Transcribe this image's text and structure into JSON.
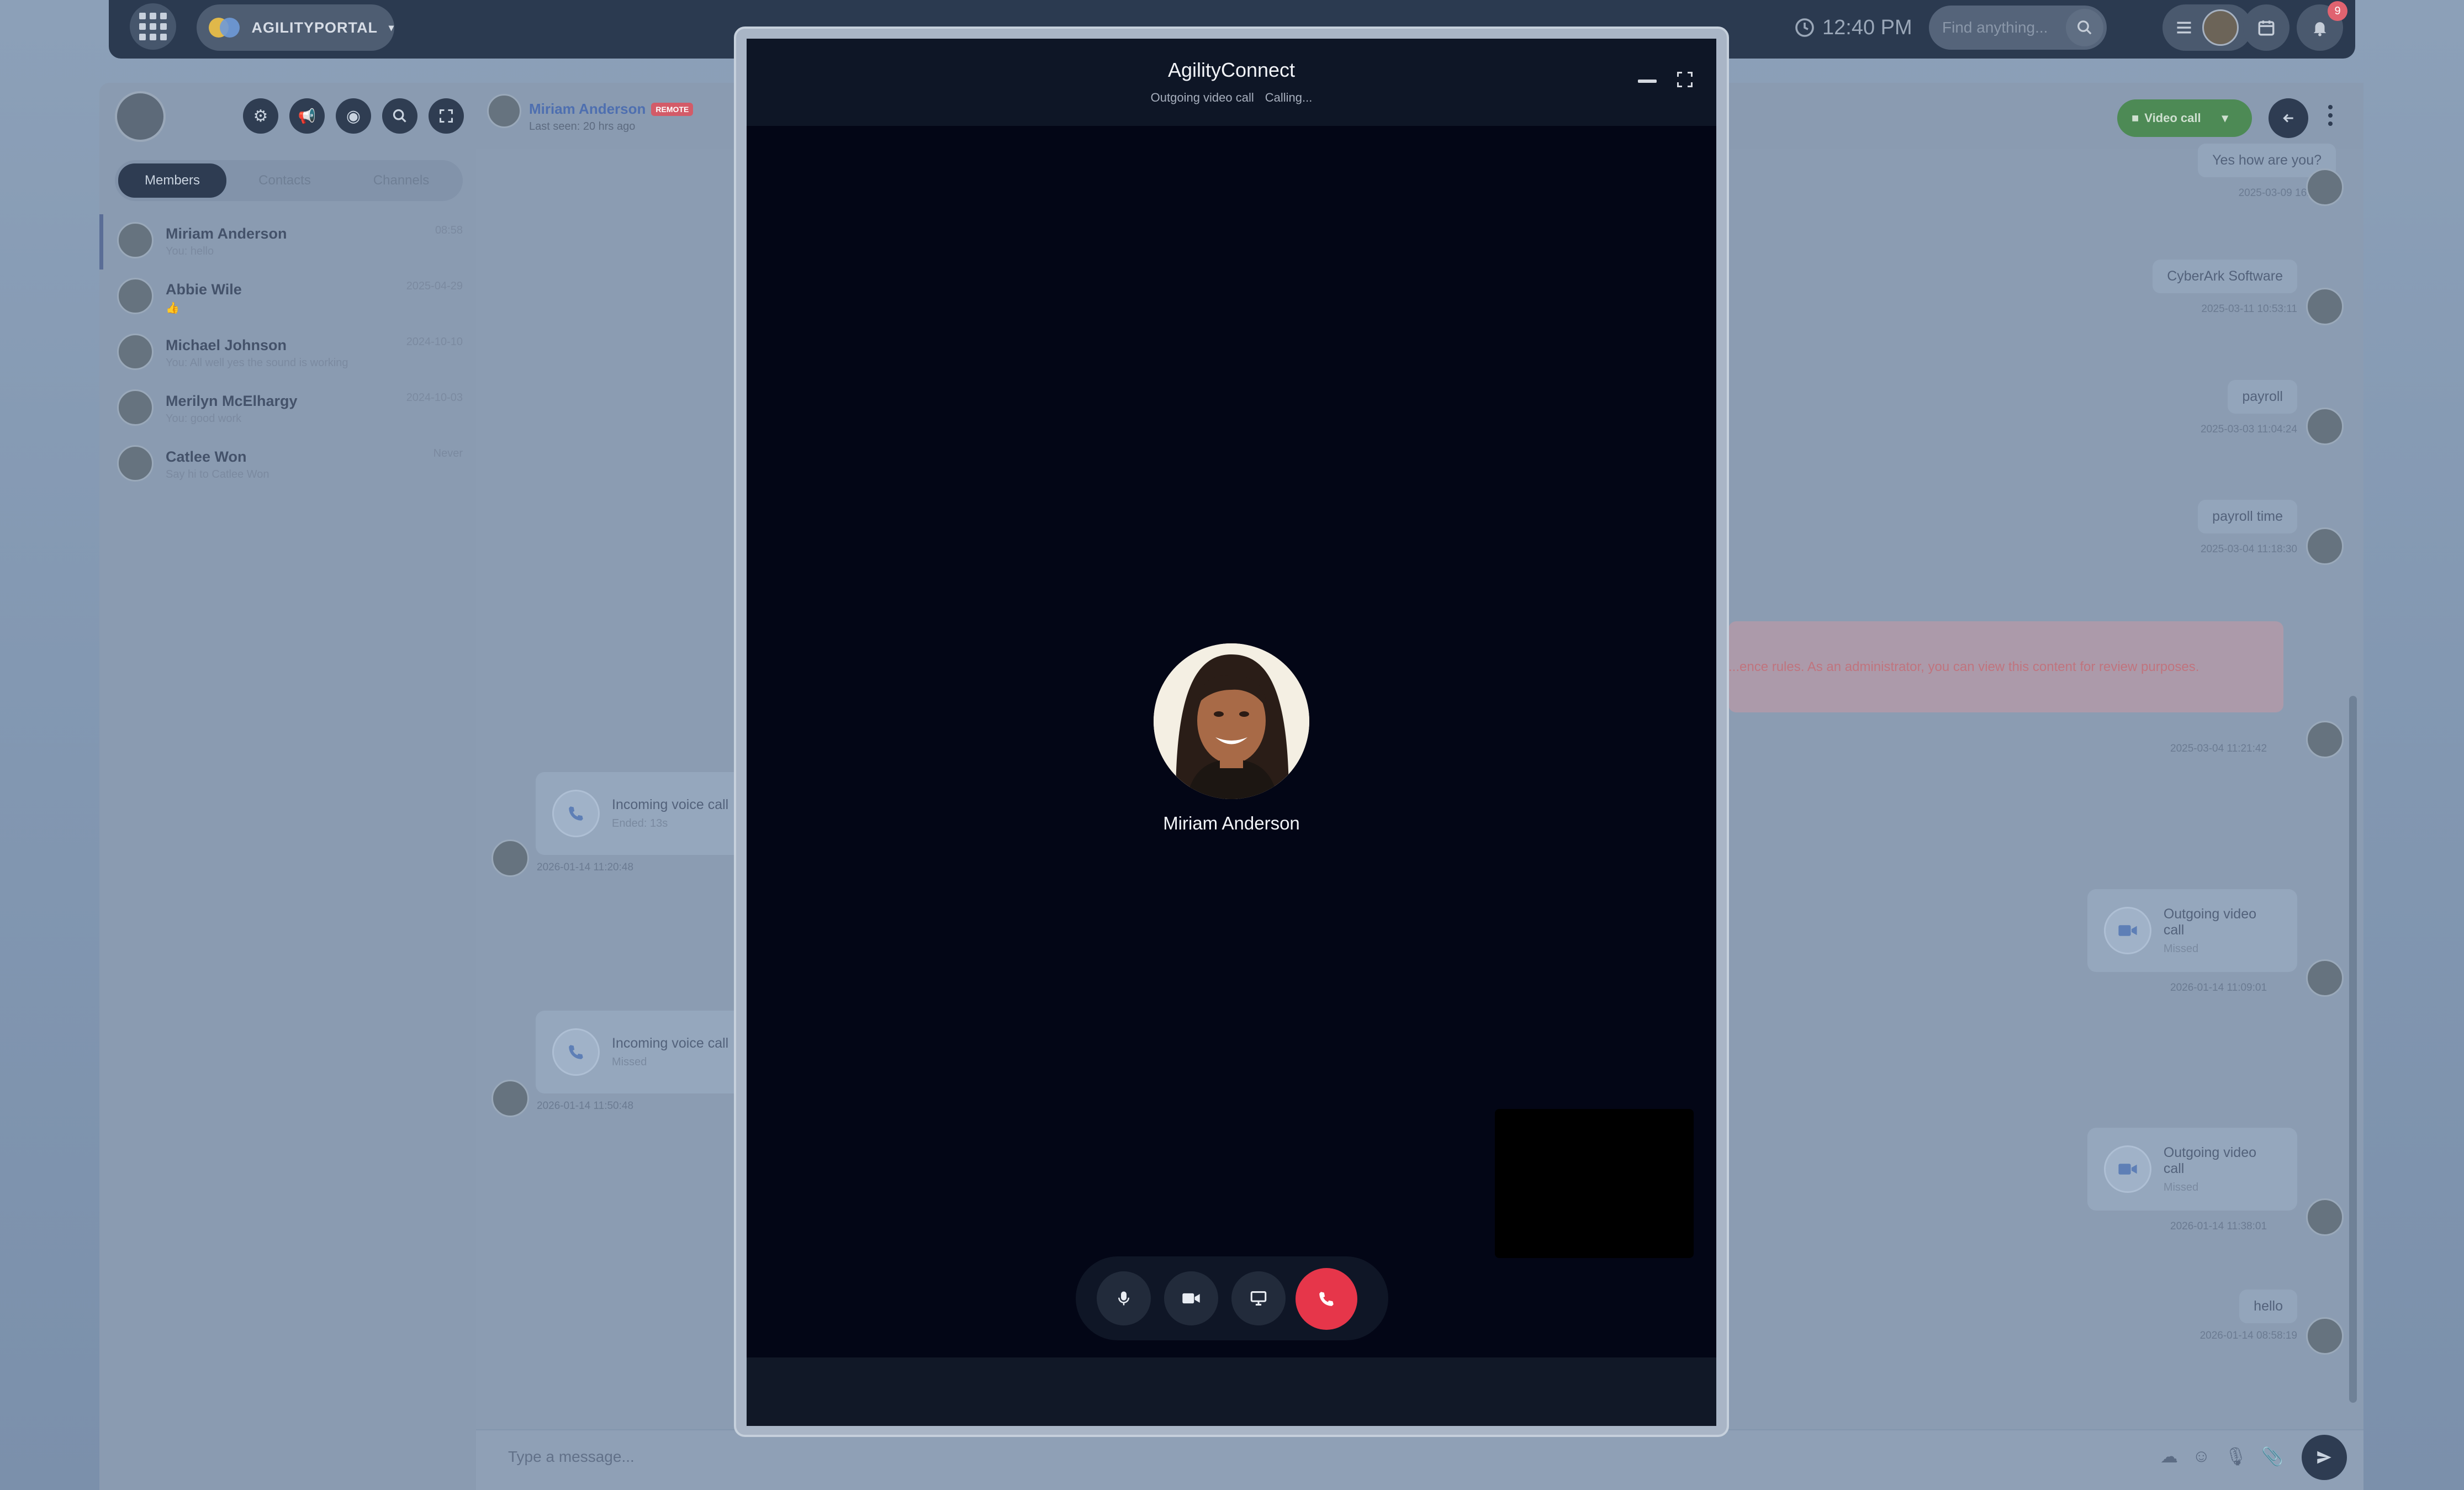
{
  "app": {
    "brand": "AGILITYPORTAL",
    "time": "12:40 PM",
    "search_placeholder": "Find anything...",
    "notification_count": "9"
  },
  "sidebar": {
    "tabs": [
      {
        "label": "Members"
      },
      {
        "label": "Contacts"
      },
      {
        "label": "Channels"
      }
    ],
    "contacts": [
      {
        "name": "Miriam Anderson",
        "preview": "You: hello",
        "date": "08:58"
      },
      {
        "name": "Abbie Wile",
        "preview": "👍",
        "date": "2025-04-29"
      },
      {
        "name": "Michael Johnson",
        "preview": "You: All well yes the sound is working",
        "date": "2024-10-10"
      },
      {
        "name": "Merilyn McElhargy",
        "preview": "You: good work",
        "date": "2024-10-03"
      },
      {
        "name": "Catlee Won",
        "preview": "Say hi to Catlee Won",
        "date": "Never"
      }
    ]
  },
  "chat": {
    "contact_name": "Miriam Anderson",
    "contact_badge": "REMOTE",
    "last_seen": "Last seen: 20 hrs ago",
    "video_call_label": "Video call",
    "composer_placeholder": "Type a message...",
    "messages_right": [
      {
        "text": "Yes how are you?",
        "time": "2025-03-09 16:39:06"
      },
      {
        "text": "CyberArk Software",
        "time": "2025-03-11 10:53:11"
      },
      {
        "text": "payroll",
        "time": "2025-03-03 11:04:24"
      },
      {
        "text": "payroll time",
        "time": "2025-03-04 11:18:30"
      }
    ],
    "admin_note": "...ence rules. As an administrator, you can view this content for review purposes.",
    "admin_note_time": "2025-03-04 11:21:42",
    "calls_left": [
      {
        "title": "Incoming voice call",
        "status": "Ended: 13s",
        "time": "2026-01-14 11:20:48"
      },
      {
        "title": "Incoming voice call",
        "status": "Missed",
        "time": "2026-01-14 11:50:48"
      }
    ],
    "calls_right": [
      {
        "title": "Outgoing video call",
        "status": "Missed",
        "time": "2026-01-14 11:09:01"
      },
      {
        "title": "Outgoing video call",
        "status": "Missed",
        "time": "2026-01-14 11:38:01"
      }
    ],
    "last_message": {
      "text": "hello",
      "time": "2026-01-14 08:58:19"
    }
  },
  "modal": {
    "title": "AgilityConnect",
    "subtitle_type": "Outgoing video call",
    "subtitle_status": "Calling...",
    "callee_name": "Miriam Anderson"
  },
  "colors": {
    "hangup": "#e6364a",
    "modal_bg": "#030616",
    "video_call_button": "#4d8a55"
  }
}
